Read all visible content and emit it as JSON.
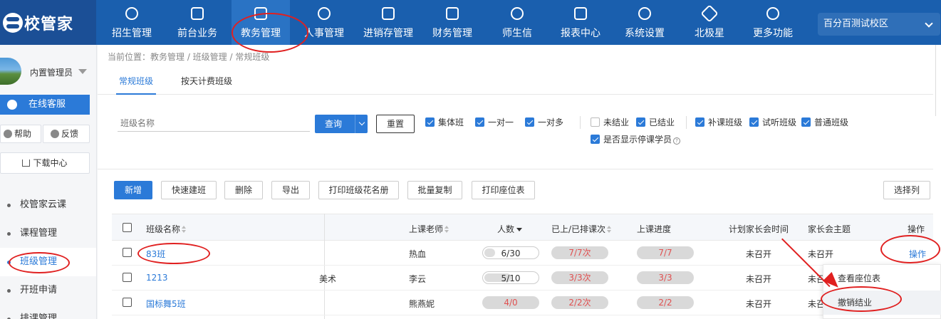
{
  "app": {
    "logo_text": "校管家",
    "school": "百分百测试校区"
  },
  "nav": [
    {
      "label": "招生管理",
      "icon": "person-add-icon"
    },
    {
      "label": "前台业务",
      "icon": "screen-icon"
    },
    {
      "label": "教务管理",
      "icon": "book-icon"
    },
    {
      "label": "人事管理",
      "icon": "person-icon"
    },
    {
      "label": "进销存管理",
      "icon": "inout-icon"
    },
    {
      "label": "财务管理",
      "icon": "yen-house-icon"
    },
    {
      "label": "师生信",
      "icon": "chat-icon"
    },
    {
      "label": "报表中心",
      "icon": "chart-icon"
    },
    {
      "label": "系统设置",
      "icon": "settings-icon"
    },
    {
      "label": "北极星",
      "icon": "star-icon"
    },
    {
      "label": "更多功能",
      "icon": "more-icon"
    }
  ],
  "sidebar": {
    "user_name": "内置管理员",
    "online_service": "在线客服",
    "help": "帮助",
    "feedback": "反馈",
    "download_center": "下载中心",
    "items": [
      {
        "label": "校管家云课"
      },
      {
        "label": "课程管理"
      },
      {
        "label": "班级管理"
      },
      {
        "label": "开班申请"
      },
      {
        "label": "排课管理"
      }
    ]
  },
  "breadcrumb": "当前位置：教务管理 / 班级管理 / 常规班级",
  "tabs": [
    {
      "label": "常规班级"
    },
    {
      "label": "按天计费班级"
    }
  ],
  "filters": {
    "search_placeholder": "班级名称",
    "query": "查询",
    "reset": "重置",
    "type_checks": [
      {
        "label": "集体班",
        "checked": true
      },
      {
        "label": "一对一",
        "checked": true
      },
      {
        "label": "一对多",
        "checked": true
      }
    ],
    "status_checks": [
      {
        "label": "未结业",
        "checked": false
      },
      {
        "label": "已结业",
        "checked": true
      },
      {
        "label": "是否显示停课学员",
        "checked": true
      }
    ],
    "class_checks": [
      {
        "label": "补课班级",
        "checked": true
      },
      {
        "label": "试听班级",
        "checked": true
      },
      {
        "label": "普通班级",
        "checked": true
      }
    ],
    "help_mark": "?"
  },
  "toolbar": {
    "add": "新增",
    "quick_create": "快速建班",
    "delete": "删除",
    "export": "导出",
    "print_roster": "打印班级花名册",
    "batch_copy": "批量复制",
    "print_seats": "打印座位表",
    "select_columns": "选择列"
  },
  "table": {
    "headers": {
      "class_name": "班级名称",
      "teacher": "上课老师",
      "count": "人数",
      "lessons": "已上/已排课次",
      "progress": "上课进度",
      "meeting_time": "计划家长会时间",
      "meeting_topic": "家长会主题",
      "operation": "操作"
    },
    "rows": [
      {
        "name": "83班",
        "extra": "",
        "teacher": "热血",
        "count": "6/30",
        "count_ratio": 0.2,
        "lessons": "7/7次",
        "progress": "7/7",
        "meeting_time": "未召开",
        "meeting_topic": "未召开",
        "op": "操作"
      },
      {
        "name": "1213",
        "extra": "美术",
        "teacher": "李云",
        "count": "5/10",
        "count_ratio": 0.5,
        "lessons": "3/3次",
        "progress": "3/3",
        "meeting_time": "未召开",
        "meeting_topic": "未召",
        "op": ""
      },
      {
        "name": "国标舞5班",
        "extra": "",
        "teacher": "熊燕妮",
        "count": "4/0",
        "count_ratio": 1.0,
        "lessons": "2/2次",
        "progress": "2/2",
        "meeting_time": "未召开",
        "meeting_topic": "未召",
        "op": ""
      }
    ]
  },
  "dropdown": {
    "view_seats": "查看座位表",
    "undo_graduate": "撤销结业"
  },
  "colors": {
    "topbar": "#1a5fae",
    "primary": "#2b7ad8",
    "annotation": "#e02020"
  }
}
